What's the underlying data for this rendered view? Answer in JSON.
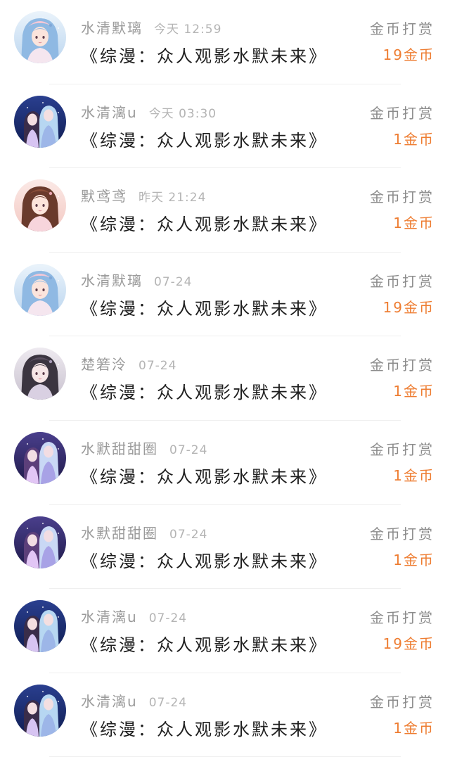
{
  "colors": {
    "amount": "#ee7d32",
    "name": "#9a9a9a",
    "time": "#b4b4b4",
    "title": "#1f1f1f",
    "action": "#8c8c8c"
  },
  "rows": [
    {
      "name": "水清默璃",
      "time": "今天  12:59",
      "title": "《综漫：众人观影水默未来》",
      "action": "金币打赏",
      "amount": "19金币",
      "avatar_theme": "pink-blue",
      "avatar_icon": "avatar-girl-pink-icon"
    },
    {
      "name": "水清漓u",
      "time": "今天  03:30",
      "title": "《综漫：众人观影水默未来》",
      "action": "金币打赏",
      "amount": "1金币",
      "avatar_theme": "blue",
      "avatar_icon": "avatar-couple-blue-icon"
    },
    {
      "name": "默鸢鸢",
      "time": "昨天  21:24",
      "title": "《综漫：众人观影水默未来》",
      "action": "金币打赏",
      "amount": "1金币",
      "avatar_theme": "peach",
      "avatar_icon": "avatar-girl-peach-icon"
    },
    {
      "name": "水清默璃",
      "time": "07-24",
      "title": "《综漫：众人观影水默未来》",
      "action": "金币打赏",
      "amount": "19金币",
      "avatar_theme": "pink-blue",
      "avatar_icon": "avatar-girl-pink-icon"
    },
    {
      "name": "楚箬泠",
      "time": "07-24",
      "title": "《综漫：众人观影水默未来》",
      "action": "金币打赏",
      "amount": "1金币",
      "avatar_theme": "grey",
      "avatar_icon": "avatar-girl-grey-icon"
    },
    {
      "name": "水默甜甜圈",
      "time": "07-24",
      "title": "《综漫：众人观影水默未来》",
      "action": "金币打赏",
      "amount": "1金币",
      "avatar_theme": "purple",
      "avatar_icon": "avatar-couple-purple-icon"
    },
    {
      "name": "水默甜甜圈",
      "time": "07-24",
      "title": "《综漫：众人观影水默未来》",
      "action": "金币打赏",
      "amount": "1金币",
      "avatar_theme": "purple",
      "avatar_icon": "avatar-couple-purple-icon"
    },
    {
      "name": "水清漓u",
      "time": "07-24",
      "title": "《综漫：众人观影水默未来》",
      "action": "金币打赏",
      "amount": "19金币",
      "avatar_theme": "blue",
      "avatar_icon": "avatar-couple-blue-icon"
    },
    {
      "name": "水清漓u",
      "time": "07-24",
      "title": "《综漫：众人观影水默未来》",
      "action": "金币打赏",
      "amount": "1金币",
      "avatar_theme": "blue",
      "avatar_icon": "avatar-couple-blue-icon"
    }
  ]
}
